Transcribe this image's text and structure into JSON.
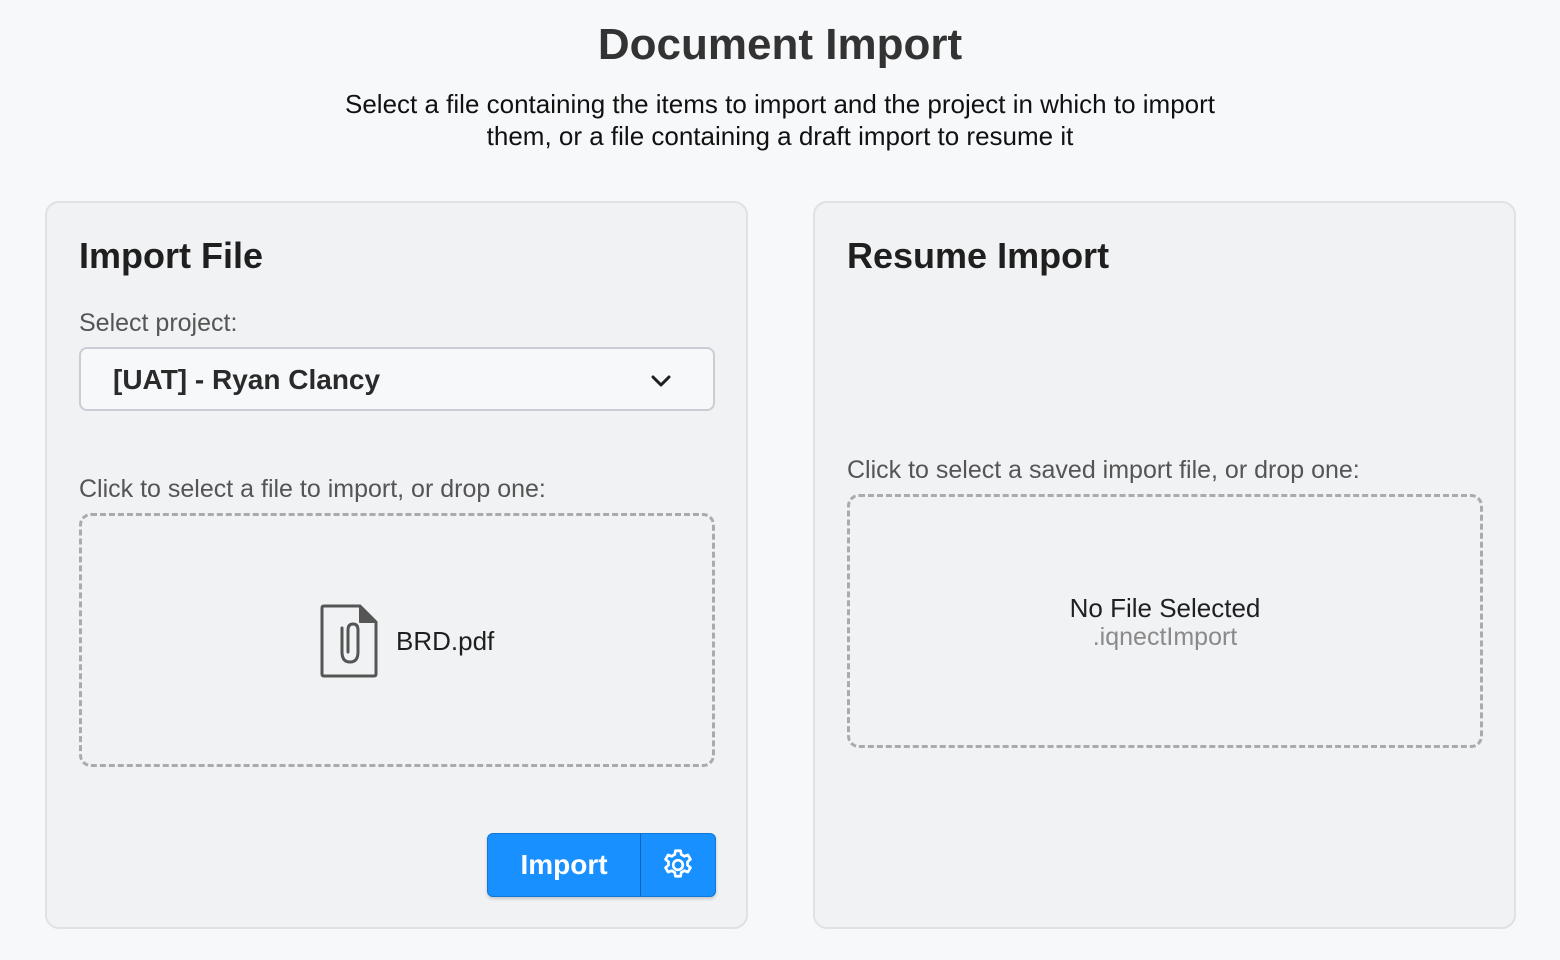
{
  "header": {
    "title": "Document Import",
    "subtitle_line1": "Select a file containing the items to import and the project in which to import",
    "subtitle_line2": "them, or a file containing a draft import to resume it"
  },
  "import_panel": {
    "heading": "Import File",
    "project_label": "Select project:",
    "project_selected": "[UAT] - Ryan Clancy",
    "dropzone_label": "Click to select a file to import, or drop one:",
    "file_name": "BRD.pdf",
    "file_icon": "paperclip-document-icon",
    "import_button_label": "Import",
    "settings_icon": "gear-icon"
  },
  "resume_panel": {
    "heading": "Resume Import",
    "dropzone_label": "Click to select a saved import file, or drop one:",
    "empty_text": "No File Selected",
    "accepted_extension": ".iqnectImport"
  },
  "colors": {
    "accent": "#1890ff",
    "background": "#f7f8fa",
    "panel": "#f1f2f4"
  }
}
